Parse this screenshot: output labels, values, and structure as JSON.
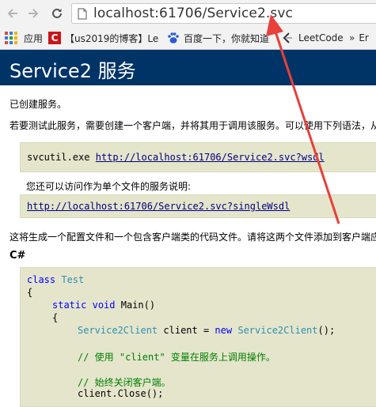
{
  "browser": {
    "url": "localhost:61706/Service2.svc",
    "bookmarks": {
      "apps": "应用",
      "blog": "【us2019的博客】Le",
      "baidu": "百度一下，你就知道",
      "leetcode": "LeetCode",
      "partial": "Er"
    }
  },
  "page": {
    "title": "Service2 服务",
    "created": "已创建服务。",
    "instructions": "若要测试此服务，需要创建一个客户端，并将其用于调用该服务。可以使用下列语法，从",
    "svcutil_cmd": "svcutil.exe",
    "wsdl_link": "http://localhost:61706/Service2.svc?wsdl",
    "single_file_note": "您还可以访问作为单个文件的服务说明:",
    "single_wsdl_link": "http://localhost:61706/Service2.svc?singleWsdl",
    "generate_note": "这将生成一个配置文件和一个包含客户端类的代码文件。请将这两个文件添加到客户端应",
    "lang_label": "C#",
    "code": {
      "kw_class": "class",
      "class_name": "Test",
      "open_brace": "{",
      "kw_static": "static",
      "kw_void": "void",
      "main_sig": "Main()",
      "inner_open": "{",
      "client_type": "Service2Client",
      "client_decl": "client =",
      "kw_new": "new",
      "ctor": "Service2Client",
      "ctor_end": "();",
      "comment1_a": "// 使用 ",
      "comment1_str": "\"client\"",
      "comment1_b": " 变量在服务上调用操作。",
      "comment2": "// 始终关闭客户端。",
      "close_call": "client.Close();"
    }
  },
  "colors": {
    "banner": "#003366",
    "code_bg": "#e5e5cc",
    "link": "#000080",
    "arrow": "#e8403a"
  }
}
